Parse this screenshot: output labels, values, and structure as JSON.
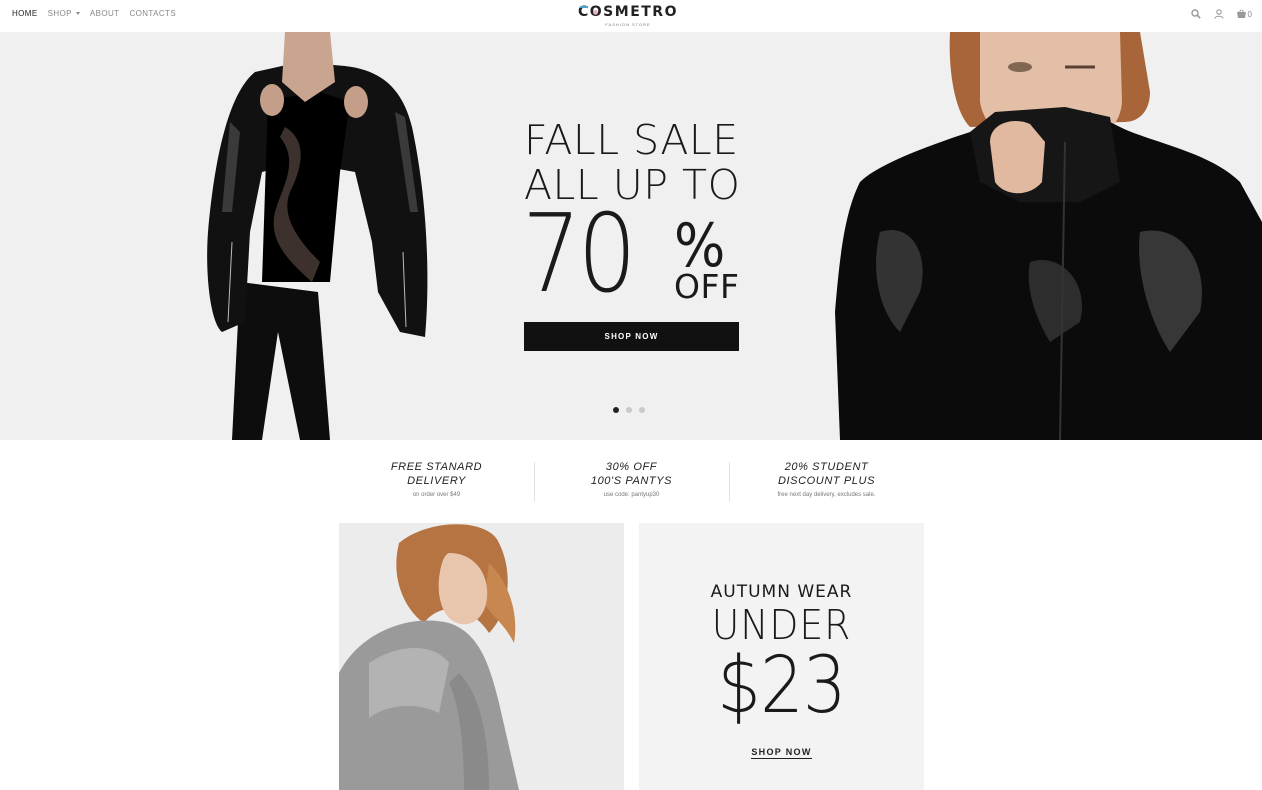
{
  "header": {
    "nav": [
      {
        "label": "HOME",
        "active": true
      },
      {
        "label": "SHOP",
        "has_dropdown": true
      },
      {
        "label": "ABOUT"
      },
      {
        "label": "CONTACTS"
      }
    ],
    "logo": {
      "name": "COSMETRO",
      "tagline": "FASHION STORE"
    },
    "icons": [
      "search-icon",
      "user-icon",
      "cart-icon"
    ],
    "cart_count": "0"
  },
  "hero": {
    "line1": "FALL SALE",
    "line2": "ALL UP TO",
    "discount": "70",
    "percent": "%",
    "off": "OFF",
    "button": "SHOP NOW",
    "slides": 3,
    "active_slide": 1
  },
  "promos": [
    {
      "title_line1": "FREE STANARD",
      "title_line2": "DELIVERY",
      "subtitle": "on order over $49"
    },
    {
      "title_line1": "30% OFF",
      "title_line2": "100'S PANTYS",
      "subtitle": "use code: pantyup30"
    },
    {
      "title_line1": "20% STUDENT",
      "title_line2": "DISCOUNT PLUS",
      "subtitle": "free next day delivery, excludes sale."
    }
  ],
  "tile_promo": {
    "line1": "AUTUMN WEAR",
    "line2": "UNDER",
    "price": "$23",
    "link": "SHOP NOW"
  },
  "colors": {
    "accent": "#111111",
    "hero_bg": "#f0f0f0",
    "tile_bg": "#f3f3f3",
    "logo_blue": "#4aa3c8",
    "logo_pink": "#e6a1b4"
  }
}
